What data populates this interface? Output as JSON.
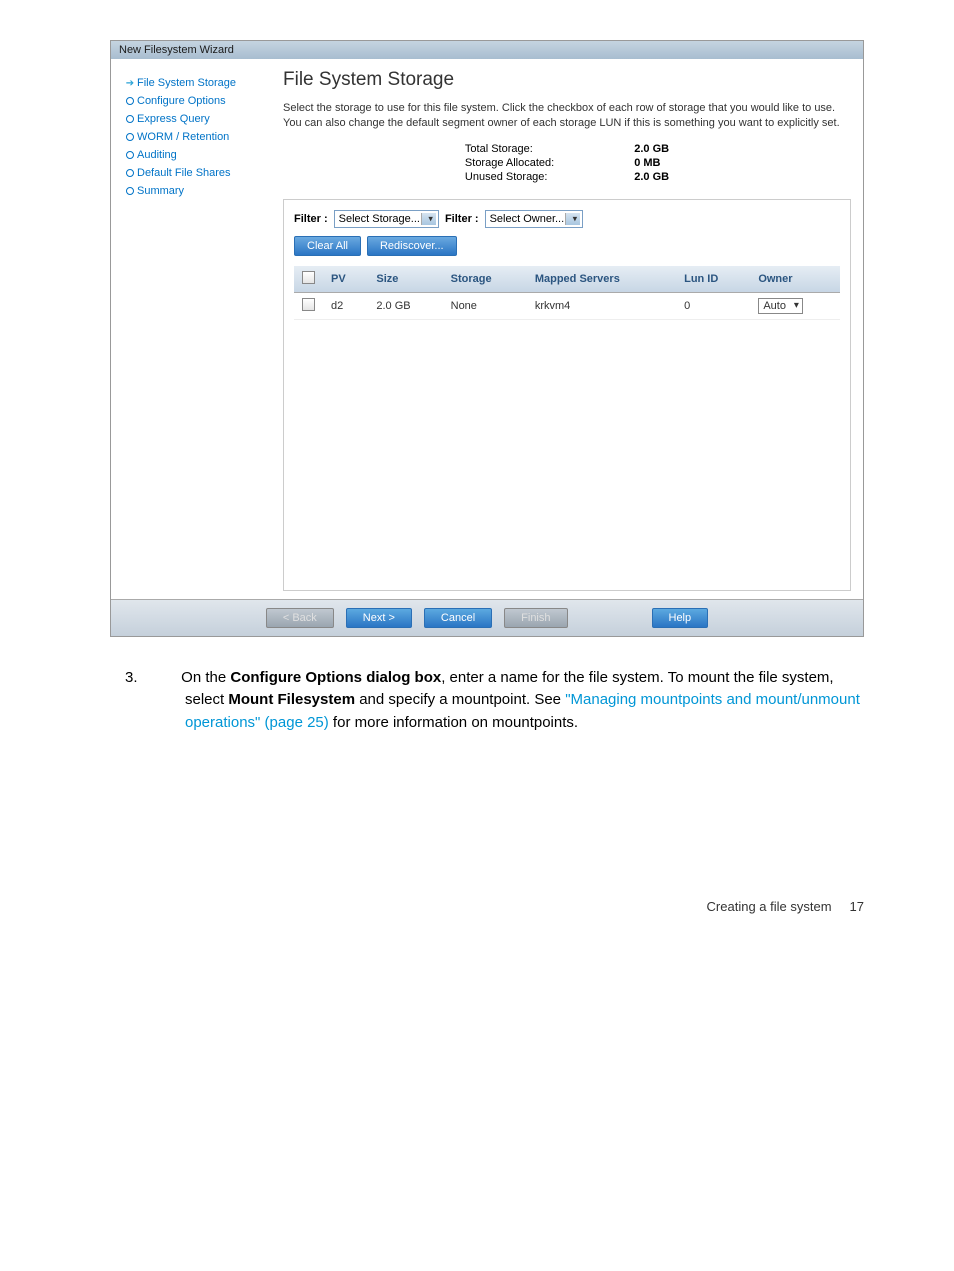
{
  "wizard": {
    "title": "New Filesystem Wizard",
    "sidebar": {
      "items": [
        {
          "label": "File System Storage",
          "current": true
        },
        {
          "label": "Configure Options"
        },
        {
          "label": "Express Query"
        },
        {
          "label": "WORM / Retention"
        },
        {
          "label": "Auditing"
        },
        {
          "label": "Default File Shares"
        },
        {
          "label": "Summary"
        }
      ]
    },
    "main": {
      "heading": "File System Storage",
      "description": "Select the storage to use for this file system. Click the checkbox of each row of storage that you would like to use. You can also change the default segment owner of each storage LUN if this is something you want to explicitly set.",
      "stats": {
        "total_label": "Total Storage:",
        "total_value": "2.0 GB",
        "allocated_label": "Storage Allocated:",
        "allocated_value": "0 MB",
        "unused_label": "Unused Storage:",
        "unused_value": "2.0 GB"
      },
      "filter1_label": "Filter :",
      "filter1_value": "Select Storage...",
      "filter2_label": "Filter :",
      "filter2_value": "Select Owner...",
      "clear_all": "Clear All",
      "rediscover": "Rediscover...",
      "table": {
        "headers": {
          "pv": "PV",
          "size": "Size",
          "storage": "Storage",
          "mapped": "Mapped Servers",
          "lun": "Lun ID",
          "owner": "Owner"
        },
        "rows": [
          {
            "pv": "d2",
            "size": "2.0 GB",
            "storage": "None",
            "mapped": "krkvm4",
            "lun": "0",
            "owner": "Auto"
          }
        ]
      }
    },
    "footer": {
      "back": "< Back",
      "next": "Next >",
      "cancel": "Cancel",
      "finish": "Finish",
      "help": "Help"
    }
  },
  "doc": {
    "step_num": "3.",
    "text_pre": "On the ",
    "bold1": "Configure Options dialog box",
    "text_mid1": ", enter a name for the file system. To mount the file system, select ",
    "bold2": "Mount Filesystem",
    "text_mid2": " and specify a mountpoint. See ",
    "link": "\"Managing mountpoints and mount/unmount operations\" (page 25)",
    "text_post": " for more information on mountpoints."
  },
  "page_footer": {
    "text": "Creating a file system",
    "num": "17"
  }
}
